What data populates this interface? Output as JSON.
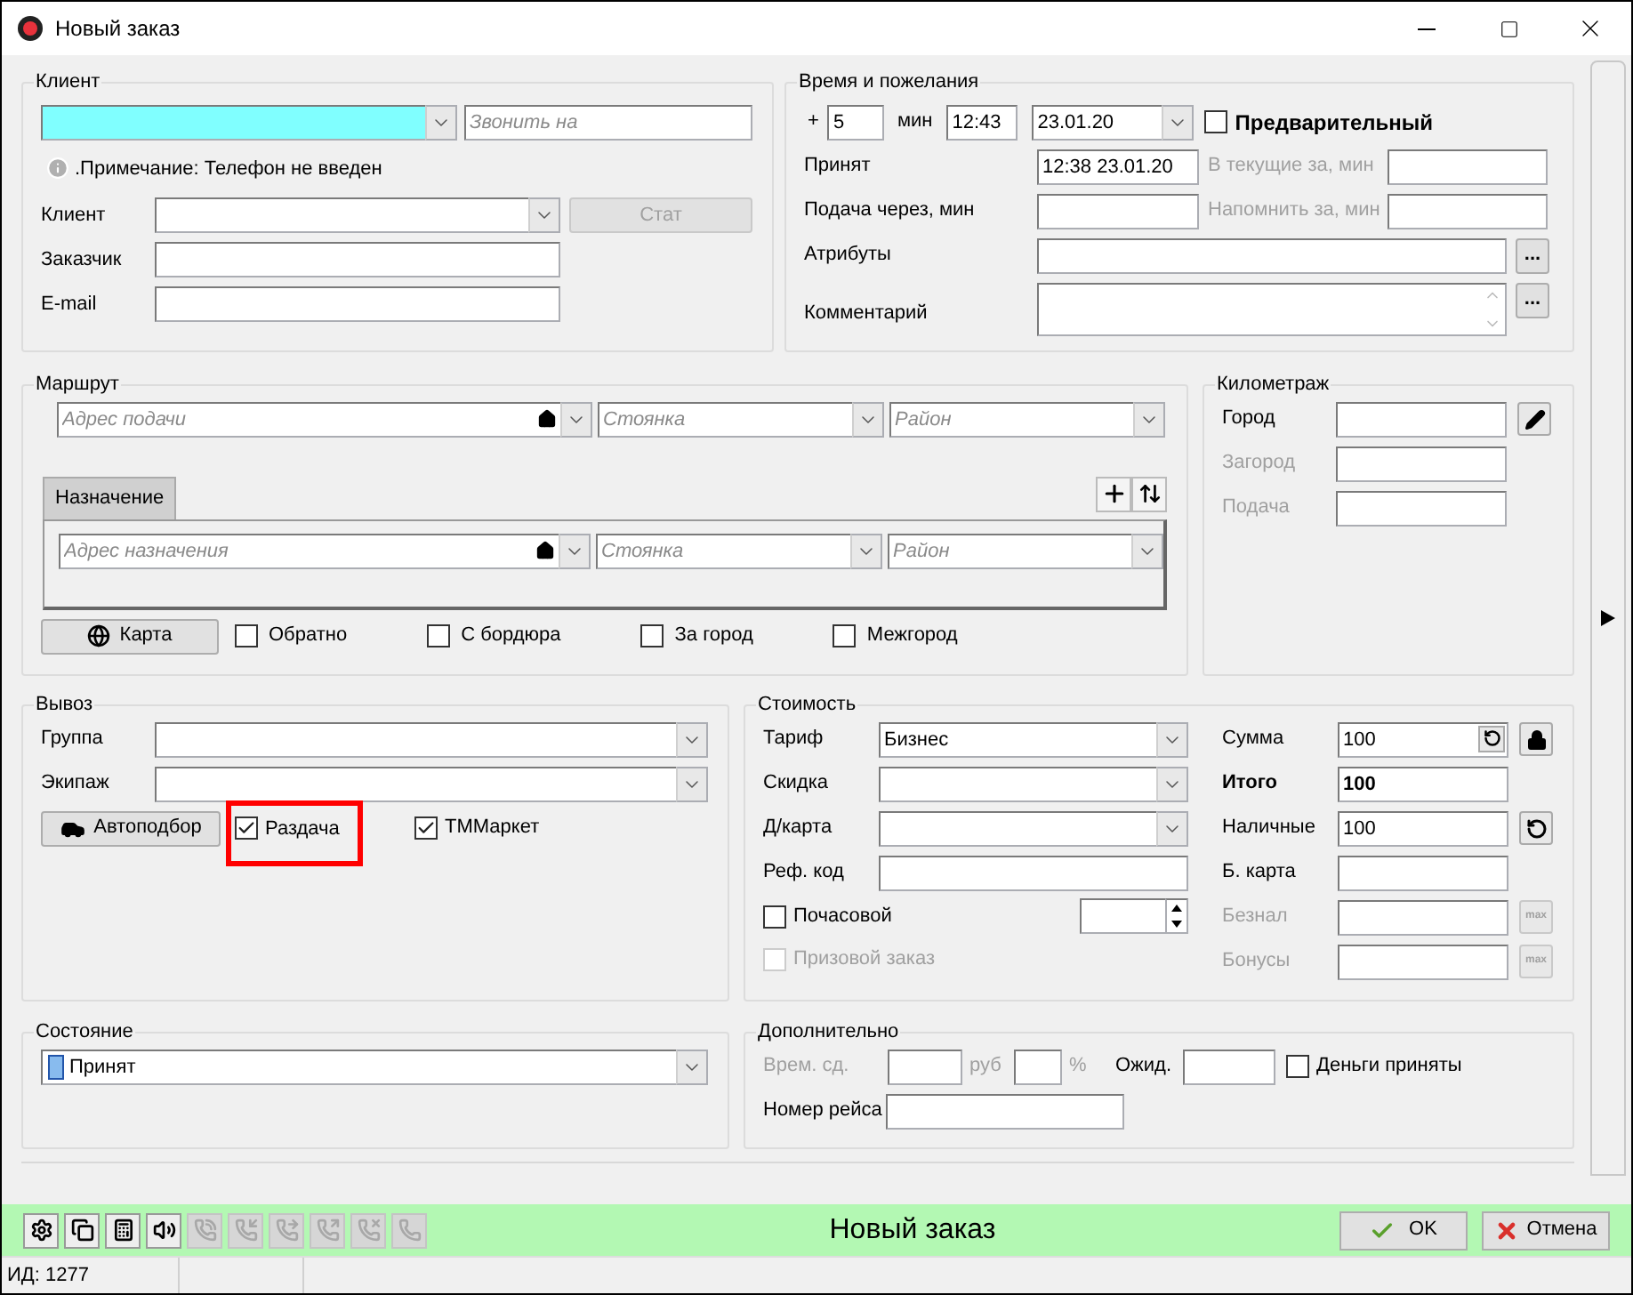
{
  "window": {
    "title": "Новый заказ"
  },
  "client": {
    "title": "Клиент",
    "phone": {
      "highlighted": true
    },
    "call_to": {
      "placeholder": "Звонить на"
    },
    "note": ".Примечание: Телефон не введен",
    "rows": [
      {
        "label": "Клиент",
        "kind": "combo"
      },
      {
        "label": "Заказчик",
        "kind": "text"
      },
      {
        "label": "E-mail",
        "kind": "text"
      }
    ],
    "stat_button": {
      "label": "Стат",
      "disabled": true
    }
  },
  "time": {
    "title": "Время и пожелания",
    "plus": "+",
    "minutes": "5",
    "minutes_unit": "мин",
    "time": "12:43",
    "date": "23.01.20",
    "preliminary": {
      "label": "Предварительный",
      "checked": false
    },
    "rows": [
      {
        "label": "Принят",
        "value": "12:38 23.01.20",
        "side_label": "В текущие за, мин",
        "side_disabled": true
      },
      {
        "label": "Подача через, мин",
        "side_label": "Напомнить за, мин",
        "side_disabled": true
      }
    ],
    "attributes": {
      "label": "Атрибуты",
      "button": "..."
    },
    "comment": {
      "label": "Комментарий",
      "button": "..."
    }
  },
  "route": {
    "title": "Маршрут",
    "pickup": {
      "address": {
        "placeholder": "Адрес подачи"
      },
      "parking": {
        "placeholder": "Стоянка"
      },
      "district": {
        "placeholder": "Район"
      }
    },
    "tabs": [
      {
        "label": "Назначение",
        "selected": true
      }
    ],
    "destination": {
      "address": {
        "placeholder": "Адрес назначения"
      },
      "parking": {
        "placeholder": "Стоянка"
      },
      "district": {
        "placeholder": "Район"
      }
    },
    "map_button": "Карта",
    "options": [
      {
        "label": "Обратно",
        "checked": false
      },
      {
        "label": "С бордюра",
        "checked": false
      },
      {
        "label": "За город",
        "checked": false
      },
      {
        "label": "Межгород",
        "checked": false
      }
    ]
  },
  "mileage": {
    "title": "Километраж",
    "rows": [
      {
        "label": "Город",
        "disabled": false,
        "kind": "edit"
      },
      {
        "label": "Загород",
        "disabled": true,
        "kind": "plain"
      },
      {
        "label": "Подача",
        "disabled": true,
        "kind": "plain"
      }
    ]
  },
  "pickup": {
    "title": "Вывоз",
    "rows": [
      {
        "label": "Группа"
      },
      {
        "label": "Экипаж"
      }
    ],
    "auto_button": "Автоподбор",
    "options": [
      {
        "label": "Раздача",
        "checked": true,
        "highlighted": true
      },
      {
        "label": "ТММаркет",
        "checked": true,
        "highlighted": false
      }
    ]
  },
  "cost": {
    "title": "Стоимость",
    "left": [
      {
        "label": "Тариф",
        "kind": "combo",
        "value": "Бизнес"
      },
      {
        "label": "Скидка",
        "kind": "combo"
      },
      {
        "label": "Д/карта",
        "kind": "combo"
      },
      {
        "label": "Реф. код",
        "kind": "text"
      }
    ],
    "hourly": {
      "label": "Почасовой",
      "checked": false,
      "disabled": false
    },
    "prize": {
      "label": "Призовой заказ",
      "checked": false,
      "disabled": true
    },
    "right": [
      {
        "label": "Сумма",
        "kind": "sum",
        "value": "100",
        "disabled": false
      },
      {
        "label": "Итого",
        "kind": "total",
        "value": "100",
        "disabled": false
      },
      {
        "label": "Наличные",
        "kind": "cash",
        "value": "100",
        "disabled": false
      },
      {
        "label": "Б. карта",
        "kind": "plain",
        "disabled": false
      },
      {
        "label": "Безнал",
        "kind": "max",
        "disabled": true,
        "button": "max"
      },
      {
        "label": "Бонусы",
        "kind": "max",
        "disabled": true,
        "button": "max"
      }
    ]
  },
  "state": {
    "title": "Состояние",
    "value": "Принят"
  },
  "extra": {
    "title": "Дополнительно",
    "wait": {
      "label": "Врем. сд.",
      "disabled": true
    },
    "rub": "руб",
    "percent": "%",
    "expect": {
      "label": "Ожид."
    },
    "money": {
      "label": "Деньги приняты",
      "checked": false
    },
    "flight": {
      "label": "Номер рейса"
    }
  },
  "toolbar": {
    "tools": [
      {
        "kind": "gear",
        "disabled": false
      },
      {
        "kind": "copy",
        "disabled": false
      },
      {
        "kind": "calculator",
        "disabled": false
      },
      {
        "kind": "speaker",
        "disabled": false
      },
      {
        "kind": "phone-call",
        "disabled": true
      },
      {
        "kind": "phone-incoming",
        "disabled": true
      },
      {
        "kind": "phone-forwarded",
        "disabled": true
      },
      {
        "kind": "phone-outgoing",
        "disabled": true
      },
      {
        "kind": "phone-missed",
        "disabled": true
      },
      {
        "kind": "phone",
        "disabled": true
      }
    ],
    "title": "Новый заказ",
    "ok": "OK",
    "cancel": "Отмена"
  },
  "status_bar": {
    "id": "ИД: 1277"
  }
}
